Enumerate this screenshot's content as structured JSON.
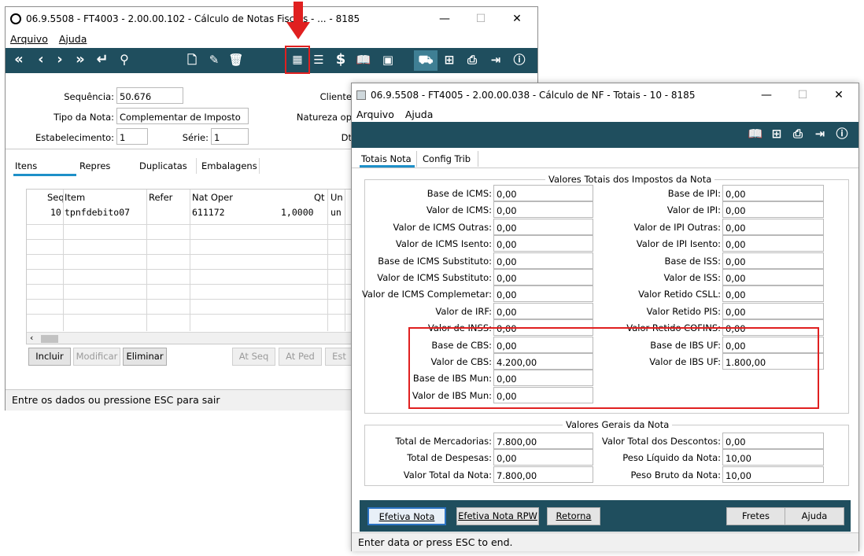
{
  "back_window": {
    "title": "06.9.5508 - FT4003 - 2.00.00.102 - Cálculo de Notas Fiscais - ... - 8185",
    "menu": [
      "Arquivo",
      "Ajuda"
    ],
    "fields": {
      "sequencia_label": "Sequência:",
      "sequencia_value": "50.676",
      "tipo_label": "Tipo da Nota:",
      "tipo_value": "Complementar de Imposto",
      "estab_label": "Estabelecimento:",
      "estab_value": "1",
      "serie_label": "Série:",
      "serie_value": "1",
      "cliente_label": "Cliente",
      "natureza_label": "Natureza op",
      "dt_label": "Dt"
    },
    "tabs": [
      "Itens",
      "Repres",
      "Duplicatas",
      "Embalagens"
    ],
    "grid": {
      "headers": [
        "Seq",
        "Item",
        "Refer",
        "Nat Oper",
        "Qt",
        "Un"
      ],
      "row": {
        "seq": "10",
        "item": "tpnfdebito07",
        "refer": "",
        "natoper": "611172",
        "qt": "1,0000",
        "un": "un"
      }
    },
    "buttons": {
      "incluir": "Incluir",
      "modificar": "Modificar",
      "eliminar": "Eliminar",
      "atseq": "At Seq",
      "atped": "At Ped",
      "est": "Est"
    },
    "status": "Entre os dados ou pressione ESC para sair"
  },
  "front_window": {
    "title": "06.9.5508 - FT4005 - 2.00.00.038 - Cálculo de NF - Totais - 10 - 8185",
    "menu": [
      "Arquivo",
      "Ajuda"
    ],
    "tabs": [
      "Totais Nota",
      "Config Trib"
    ],
    "group1_title": "Valores Totais dos Impostos da Nota",
    "left_fields": [
      {
        "label": "Base de ICMS:",
        "value": "0,00"
      },
      {
        "label": "Valor de ICMS:",
        "value": "0,00"
      },
      {
        "label": "Valor de ICMS Outras:",
        "value": "0,00"
      },
      {
        "label": "Valor de ICMS Isento:",
        "value": "0,00"
      },
      {
        "label": "Base de ICMS Substituto:",
        "value": "0,00"
      },
      {
        "label": "Valor de ICMS Substituto:",
        "value": "0,00"
      },
      {
        "label": "Valor de ICMS Complemetar:",
        "value": "0,00"
      },
      {
        "label": "Valor de IRF:",
        "value": "0,00"
      },
      {
        "label": "Valor de INSS:",
        "value": "0,00"
      },
      {
        "label": "Base de CBS:",
        "value": "0,00"
      },
      {
        "label": "Valor de CBS:",
        "value": "4.200,00"
      },
      {
        "label": "Base de IBS Mun:",
        "value": "0,00"
      },
      {
        "label": "Valor de IBS Mun:",
        "value": "0,00"
      }
    ],
    "right_fields": [
      {
        "label": "Base de IPI:",
        "value": "0,00"
      },
      {
        "label": "Valor de IPI:",
        "value": "0,00"
      },
      {
        "label": "Valor de IPI Outras:",
        "value": "0,00"
      },
      {
        "label": "Valor de IPI Isento:",
        "value": "0,00"
      },
      {
        "label": "Base de ISS:",
        "value": "0,00"
      },
      {
        "label": "Valor de ISS:",
        "value": "0,00"
      },
      {
        "label": "Valor Retido CSLL:",
        "value": "0,00"
      },
      {
        "label": "Valor Retido PIS:",
        "value": "0,00"
      },
      {
        "label": "Valor Retido COFINS:",
        "value": "0,00"
      },
      {
        "label": "Base de IBS UF:",
        "value": "0,00"
      },
      {
        "label": "Valor de IBS UF:",
        "value": "1.800,00"
      }
    ],
    "group2_title": "Valores Gerais da Nota",
    "gerais_left": [
      {
        "label": "Total de Mercadorias:",
        "value": "7.800,00"
      },
      {
        "label": "Total de Despesas:",
        "value": "0,00"
      },
      {
        "label": "Valor Total da Nota:",
        "value": "7.800,00"
      }
    ],
    "gerais_right": [
      {
        "label": "Valor Total dos Descontos:",
        "value": "0,00"
      },
      {
        "label": "Peso Líquido da Nota:",
        "value": "10,00"
      },
      {
        "label": "Peso Bruto da Nota:",
        "value": "10,00"
      }
    ],
    "buttons": {
      "efetiva": "Efetiva Nota",
      "efetiva_rpw": "Efetiva Nota RPW",
      "retorna": "Retorna",
      "fretes": "Fretes",
      "ajuda": "Ajuda"
    },
    "status": "Enter data or press ESC to end."
  },
  "colors": {
    "toolbar": "#1f4e5e",
    "highlight": "#e02020",
    "tab_active": "#1e90c8"
  },
  "icons": [
    "first-icon",
    "prev-icon",
    "next-icon",
    "last-icon",
    "enter-icon",
    "search-icon",
    "new-doc-icon",
    "edit-doc-icon",
    "trash-icon",
    "calculator-icon",
    "list-icon",
    "dollar-icon",
    "book-icon",
    "doc-icon",
    "truck-icon",
    "tree-icon",
    "print-icon",
    "exit-icon",
    "help-icon"
  ]
}
